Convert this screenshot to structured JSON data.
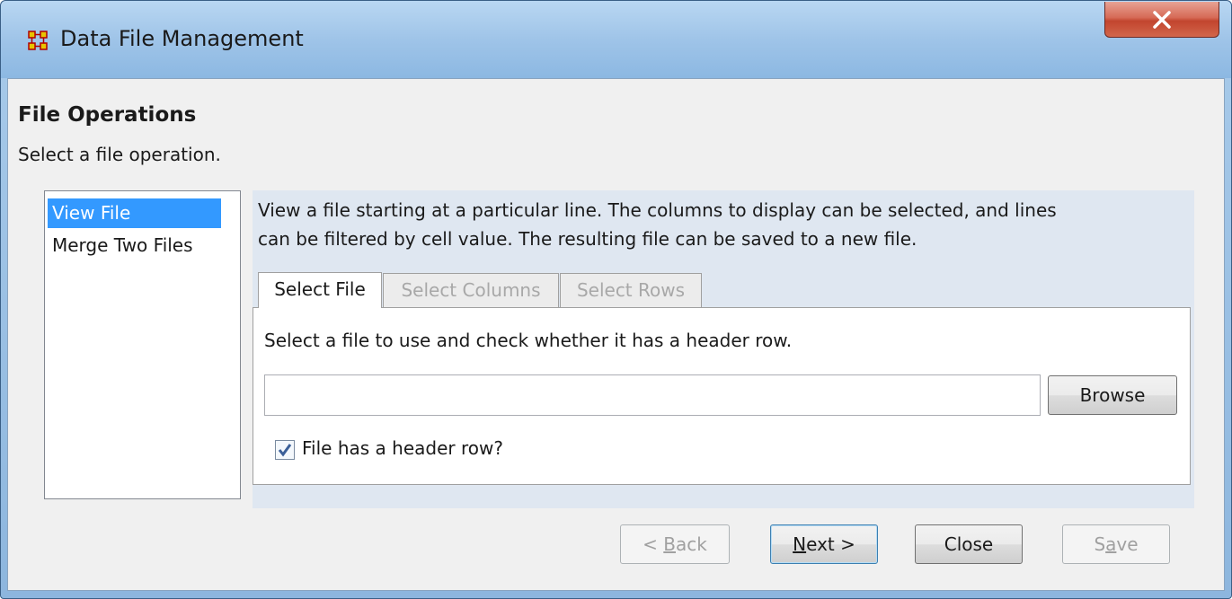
{
  "window": {
    "title": "Data File Management"
  },
  "header": {
    "title": "File Operations",
    "subtitle": "Select a file operation."
  },
  "operations": {
    "items": [
      {
        "label": "View File",
        "selected": true
      },
      {
        "label": "Merge Two Files",
        "selected": false
      }
    ]
  },
  "detail": {
    "description_line1": "View a file starting at a particular line. The columns to display can be selected, and lines",
    "description_line2": "can be filtered by cell value. The resulting file can be saved to a new file.",
    "tabs": [
      {
        "label": "Select File",
        "state": "active"
      },
      {
        "label": "Select Columns",
        "state": "disabled"
      },
      {
        "label": "Select Rows",
        "state": "disabled"
      }
    ],
    "select_file": {
      "hint": "Select a file to use and check whether it has a header row.",
      "path_value": "",
      "browse_label": "Browse",
      "header_row_label": "File has a header row?",
      "header_row_checked": true
    }
  },
  "footer": {
    "back_prefix": "< ",
    "back_mnemonic": "B",
    "back_rest": "ack",
    "next_mnemonic": "N",
    "next_rest": "ext >",
    "close_label": "Close",
    "save_pre": "S",
    "save_mnemonic": "a",
    "save_rest": "ve"
  },
  "colors": {
    "selection": "#3399ff",
    "close_button": "#c2452e",
    "title_bar": "#9fc4e8"
  }
}
